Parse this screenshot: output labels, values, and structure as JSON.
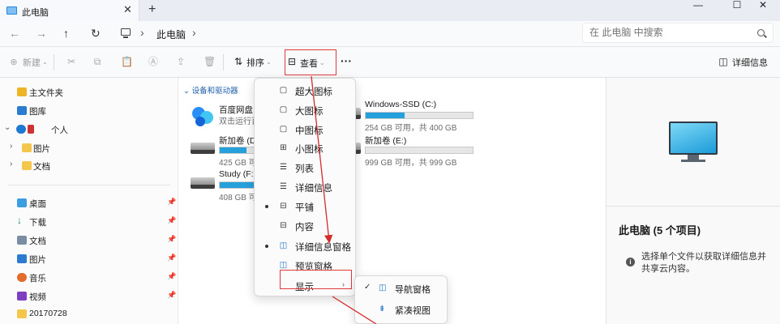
{
  "window": {
    "tab_title": "此电脑",
    "tab_close": "✕",
    "new_tab": "+",
    "minimize": "—",
    "maximize": "☐",
    "close": "✕"
  },
  "address": {
    "back": "←",
    "forward": "→",
    "up": "↑",
    "refresh": "↻",
    "breadcrumb": [
      "此电脑"
    ],
    "sep": "›",
    "search_placeholder": "在 此电脑 中搜索"
  },
  "command_bar": {
    "new_label": "新建",
    "sort_label": "排序",
    "view_label": "查看",
    "more": "···",
    "details_label": "详细信息"
  },
  "sidebar": {
    "items": [
      {
        "label": "主文件夹"
      },
      {
        "label": "图库"
      },
      {
        "label": "个人"
      },
      {
        "label": "图片"
      },
      {
        "label": "文档"
      }
    ],
    "quick_access": [
      {
        "label": "桌面"
      },
      {
        "label": "下载"
      },
      {
        "label": "文档"
      },
      {
        "label": "图片"
      },
      {
        "label": "音乐"
      },
      {
        "label": "视频"
      },
      {
        "label": "20170728"
      }
    ]
  },
  "main": {
    "group_header": "设备和驱动器",
    "items": [
      {
        "name": "百度网盘",
        "subtitle": "双击运行百"
      },
      {
        "name": "新加卷 (D:",
        "size": "425 GB 可用",
        "used_fraction": 0.25
      },
      {
        "name": "Study (F:)",
        "size": "408 GB 可用",
        "used_fraction": 0.32
      },
      {
        "name": "Windows-SSD (C:)",
        "size": "254 GB 可用，共 400 GB",
        "used_fraction": 0.36
      },
      {
        "name": "新加卷 (E:)",
        "size": "999 GB 可用，共 999 GB",
        "used_fraction": 0.0
      }
    ]
  },
  "view_menu": {
    "items": [
      {
        "label": "超大图标",
        "icon": "▢"
      },
      {
        "label": "大图标",
        "icon": "▢"
      },
      {
        "label": "中图标",
        "icon": "▢"
      },
      {
        "label": "小图标",
        "icon": "⊞"
      },
      {
        "label": "列表",
        "icon": "☰"
      },
      {
        "label": "详细信息",
        "icon": "☰"
      },
      {
        "label": "平铺",
        "icon": "⊟"
      },
      {
        "label": "内容",
        "icon": "⊟"
      },
      {
        "label": "详细信息窗格",
        "icon": "◫"
      },
      {
        "label": "预览窗格",
        "icon": "◫"
      },
      {
        "label": "显示",
        "icon": ""
      }
    ],
    "show_arrow": "›"
  },
  "show_submenu": {
    "items": [
      {
        "label": "导航窗格",
        "check": "✓",
        "icon": "◫"
      },
      {
        "label": "紧凑视图",
        "check": "",
        "icon": "⇟"
      }
    ]
  },
  "details_pane": {
    "title": "此电脑 (5 个项目)",
    "info_icon": "i",
    "message": "选择单个文件以获取详细信息并共享云内容。"
  },
  "colors": {
    "accent": "#26a0da",
    "highlight_box": "#e0393e",
    "link": "#1e5ea8"
  }
}
